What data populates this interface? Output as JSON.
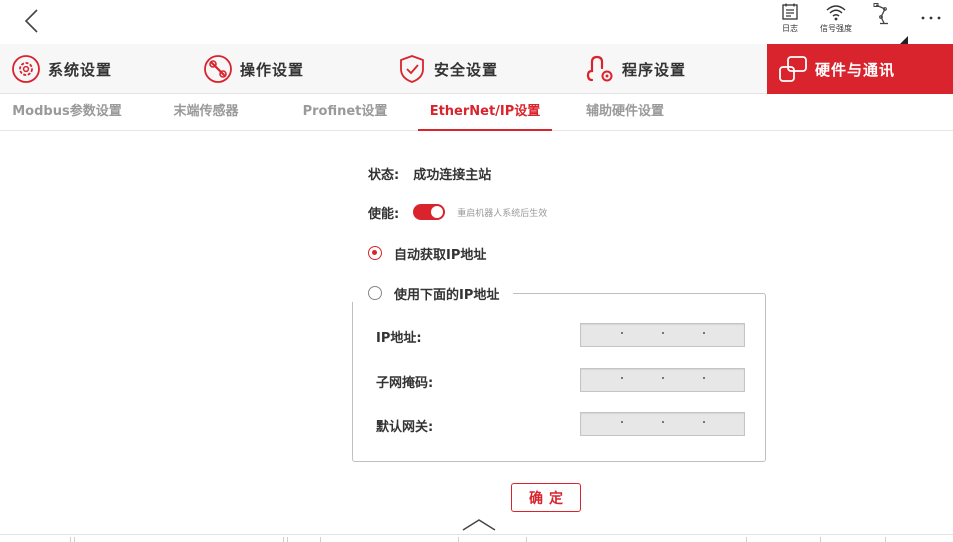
{
  "toolbar": {
    "log_label": "日志",
    "signal_label": "信号强度"
  },
  "main_tabs": [
    {
      "label": "系统设置",
      "icon": "gear-circle-icon"
    },
    {
      "label": "操作设置",
      "icon": "wrench-circle-icon"
    },
    {
      "label": "安全设置",
      "icon": "shield-check-icon"
    },
    {
      "label": "程序设置",
      "icon": "program-node-icon"
    },
    {
      "label": "硬件与通讯",
      "icon": "hardware-blocks-icon",
      "active": true
    }
  ],
  "sub_tabs": [
    {
      "label": "Modbus参数设置"
    },
    {
      "label": "末端传感器"
    },
    {
      "label": "Profinet设置"
    },
    {
      "label": "EtherNet/IP设置",
      "active": true
    },
    {
      "label": "辅助硬件设置"
    }
  ],
  "status": {
    "label": "状态:",
    "value": "成功连接主站"
  },
  "enable": {
    "label": "使能:",
    "on": true,
    "hint": "重启机器人系统后生效"
  },
  "ip_mode": {
    "auto_label": "自动获取IP地址",
    "manual_label": "使用下面的IP地址",
    "selected": "auto"
  },
  "ip_fields": [
    {
      "label": "IP地址:",
      "value": ". . ."
    },
    {
      "label": "子网掩码:",
      "value": ". . ."
    },
    {
      "label": "默认网关:",
      "value": ". . ."
    }
  ],
  "confirm_label": "确定",
  "colors": {
    "accent": "#d9232d",
    "tab_bg": "#f7f7f7",
    "inactive_text": "#9a9a9a"
  }
}
